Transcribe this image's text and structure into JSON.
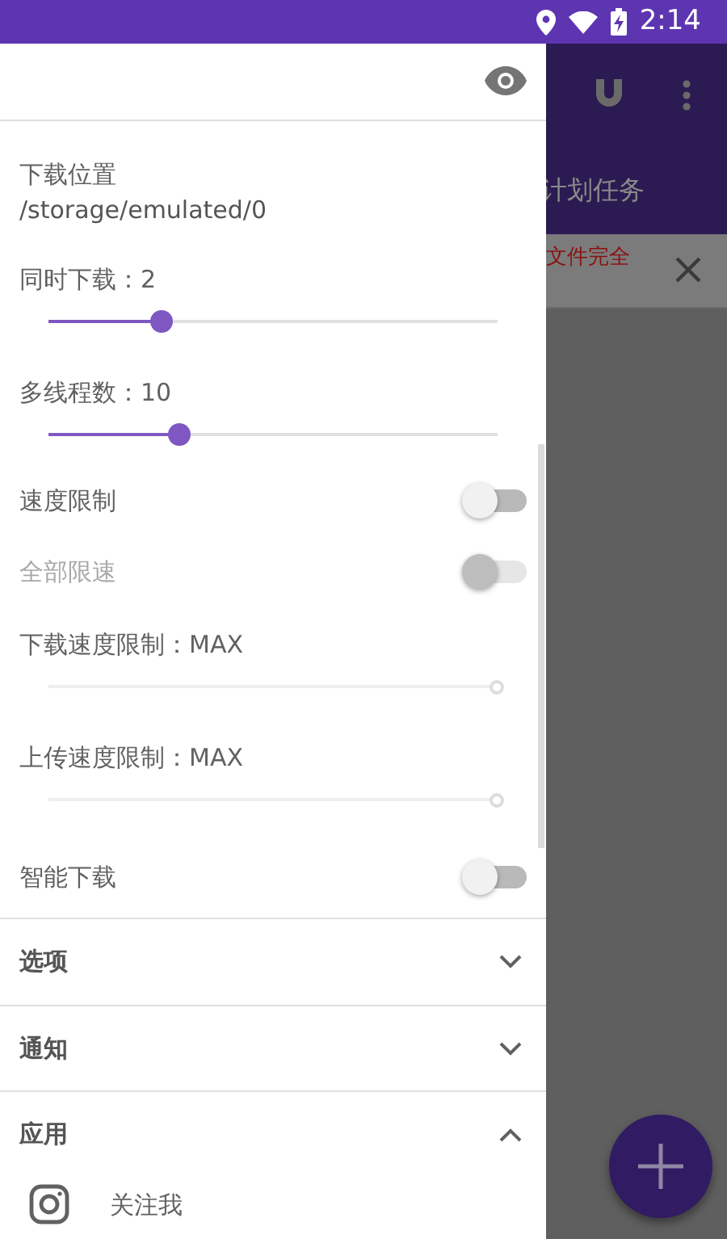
{
  "status_bar": {
    "time": "2:14"
  },
  "background": {
    "toolbar_text": "计划任务",
    "banner_text": "文件完全"
  },
  "drawer": {
    "settings": [
      {
        "kind": "text",
        "label": "下载位置",
        "value": "/storage/emulated/0"
      },
      {
        "kind": "slider",
        "label": "同时下载：2",
        "level": 0.25,
        "disabled": false
      },
      {
        "kind": "slider",
        "label": "多线程数：10",
        "level": 0.29,
        "disabled": false
      },
      {
        "kind": "switch",
        "label": "速度限制",
        "on": false,
        "disabled": false
      },
      {
        "kind": "switch",
        "label": "全部限速",
        "on": false,
        "disabled": true
      },
      {
        "kind": "slider",
        "label": "下载速度限制：MAX",
        "level": 1,
        "disabled": true
      },
      {
        "kind": "slider",
        "label": "上传速度限制：MAX",
        "level": 1,
        "disabled": true
      },
      {
        "kind": "switch",
        "label": "智能下载",
        "on": false,
        "disabled": false
      }
    ],
    "sections": [
      {
        "title": "选项",
        "expanded": false
      },
      {
        "title": "通知",
        "expanded": false
      },
      {
        "title": "应用",
        "expanded": true,
        "items": [
          {
            "label": "关注我"
          }
        ]
      }
    ]
  }
}
